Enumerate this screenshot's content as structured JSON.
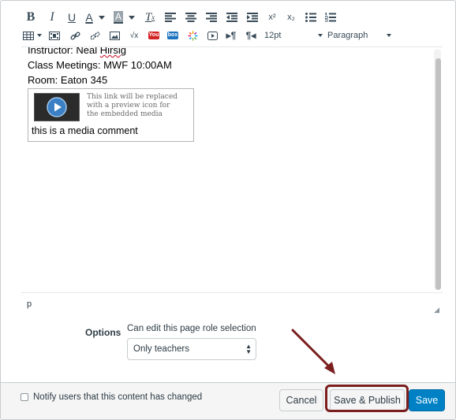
{
  "toolbar": {
    "row1": [
      "bold-icon",
      "italic-icon",
      "underline-icon",
      "font-color-icon",
      "background-color-icon",
      "clear-formatting-icon",
      "align-left-icon",
      "align-center-icon",
      "align-right-icon",
      "outdent-icon",
      "indent-icon",
      "superscript-icon",
      "subscript-icon",
      "bullet-list-icon",
      "numbered-list-icon"
    ],
    "font_size": "12pt",
    "block_format": "Paragraph",
    "labels": {
      "bold": "B",
      "italic": "I",
      "underline": "U",
      "font_color": "A",
      "bg_color": "A",
      "clear": "T",
      "superscript": "x²",
      "subscript": "x₂",
      "math": "√x",
      "youtube": "You",
      "box": "box"
    }
  },
  "editor": {
    "line1_prefix": "Instructor: Neal ",
    "line1_name": "Hirsig",
    "line2": "Class Meetings: MWF 10:00AM",
    "line3": "Room: Eaton 345",
    "media_note": [
      "This link will be replaced",
      "with a preview icon for",
      "the embedded media"
    ],
    "media_caption": "this is a media comment",
    "path": "p"
  },
  "options": {
    "label": "Options",
    "description": "Can edit this page role selection",
    "selected": "Only teachers"
  },
  "footer": {
    "notify_label": "Notify users that this content has changed",
    "cancel": "Cancel",
    "save_publish": "Save & Publish",
    "save": "Save"
  },
  "colors": {
    "accent": "#0081c6",
    "highlight": "#7b1e1e",
    "misspell": "#d0021b"
  }
}
